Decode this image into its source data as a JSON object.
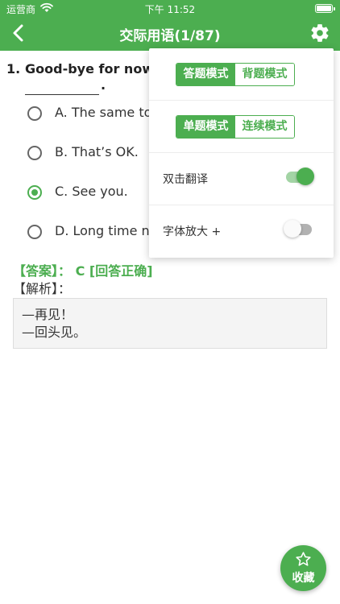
{
  "status_bar": {
    "carrier": "运营商",
    "time": "下午 11:52",
    "wifi_icon": "wifi-icon",
    "battery_icon": "battery-icon"
  },
  "nav": {
    "title": "交际用语(1/87)",
    "back_icon": "chevron-left-icon",
    "settings_icon": "gear-icon"
  },
  "question": {
    "number": "1.",
    "text": "Good-bye for now.",
    "blank_suffix": ".",
    "options": [
      {
        "label": "A. The same to",
        "selected": false
      },
      {
        "label": "B. That’s OK.",
        "selected": false
      },
      {
        "label": "C. See you.",
        "selected": true
      },
      {
        "label": "D. Long time no",
        "selected": false
      }
    ]
  },
  "answer": {
    "line": "【答案】： C  [回答正确]",
    "analysis_label": "【解析】：",
    "analysis_lines": [
      "—再见！",
      "—回头见。"
    ]
  },
  "settings_menu": {
    "mode_segment": {
      "options": [
        "答题模式",
        "背题模式"
      ],
      "selected": "答题模式"
    },
    "flow_segment": {
      "options": [
        "单题模式",
        "连续模式"
      ],
      "selected": "单题模式"
    },
    "double_tap_translate": {
      "label": "双击翻译",
      "on": true
    },
    "font_enlarge": {
      "label": "字体放大 +",
      "on": false
    }
  },
  "fab": {
    "label": "收藏",
    "icon": "star-icon"
  },
  "colors": {
    "accent": "#4cae50",
    "accent_light": "#a3d4a5",
    "toggle_off": "#b2b2b2"
  }
}
